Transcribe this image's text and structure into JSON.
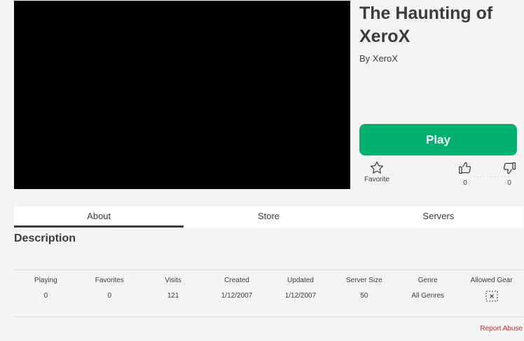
{
  "game": {
    "title": "The Haunting of XeroX",
    "byline": "By XeroX",
    "play_label": "Play",
    "favorite_label": "Favorite",
    "upvotes": "0",
    "downvotes": "0"
  },
  "tabs": [
    "About",
    "Store",
    "Servers"
  ],
  "description": {
    "heading": "Description"
  },
  "stats": {
    "labels": [
      "Playing",
      "Favorites",
      "Visits",
      "Created",
      "Updated",
      "Server Size",
      "Genre",
      "Allowed Gear"
    ],
    "values": [
      "0",
      "0",
      "121",
      "1/12/2007",
      "1/12/2007",
      "50",
      "All Genres"
    ]
  },
  "report_label": "Report Abuse",
  "colors": {
    "play": "#00b06f",
    "report": "#e2231a"
  },
  "icons": [
    "star-icon",
    "thumbs-up-icon",
    "thumbs-down-icon",
    "gear-unavailable-icon"
  ]
}
